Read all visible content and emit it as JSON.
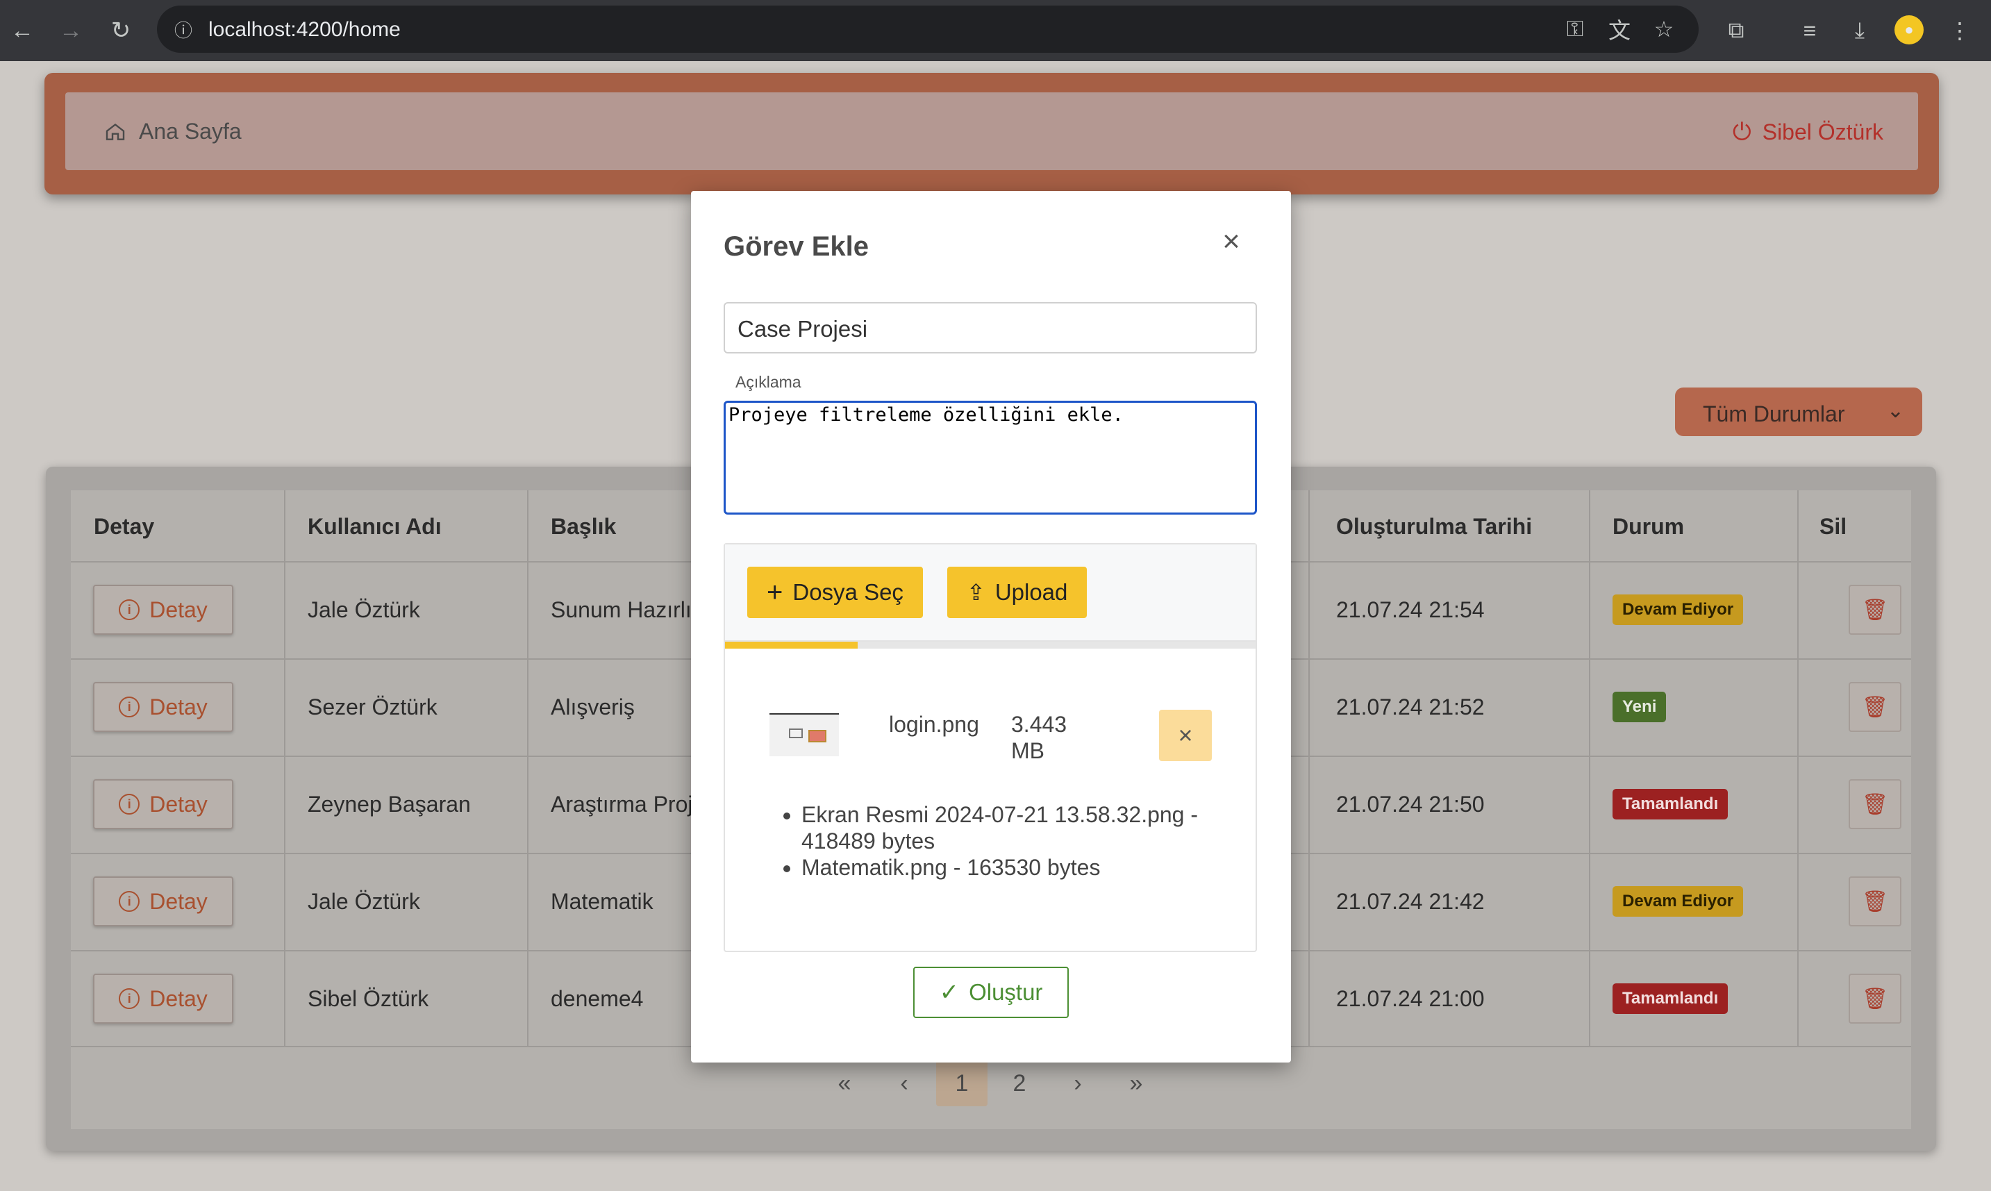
{
  "browser": {
    "url": "localhost:4200/home"
  },
  "header": {
    "home_label": "Ana Sayfa",
    "user_name": "Sibel Öztürk"
  },
  "filter": {
    "selected": "Tüm Durumlar"
  },
  "table": {
    "columns": [
      "Detay",
      "Kullanıcı Adı",
      "Başlık",
      "Oluşturulma Tarihi",
      "Durum",
      "Sil"
    ],
    "detail_label": "Detay",
    "rows": [
      {
        "user": "Jale Öztürk",
        "title": "Sunum Hazırlı",
        "date": "21.07.24 21:54",
        "status": "Devam Ediyor"
      },
      {
        "user": "Sezer Öztürk",
        "title": "Alışveriş",
        "date": "21.07.24 21:52",
        "status": "Yeni"
      },
      {
        "user": "Zeynep Başaran",
        "title": "Araştırma Proj",
        "date": "21.07.24 21:50",
        "status": "Tamamlandı"
      },
      {
        "user": "Jale Öztürk",
        "title": "Matematik",
        "date": "21.07.24 21:42",
        "status": "Devam Ediyor"
      },
      {
        "user": "Sibel Öztürk",
        "title": "deneme4",
        "date": "21.07.24 21:00",
        "status": "Tamamlandı"
      }
    ]
  },
  "pagination": {
    "first": "«",
    "prev": "‹",
    "pages": [
      "1",
      "2"
    ],
    "current": "1",
    "next": "›",
    "last": "»"
  },
  "modal": {
    "title": "Görev Ekle",
    "title_value": "Case Projesi",
    "description_label": "Açıklama",
    "description_value": "Projeye filtreleme özelliğini ekle.",
    "choose_file_label": "Dosya Seç",
    "upload_label": "Upload",
    "upload_progress_percent": 25,
    "pending_file": {
      "name": "login.png",
      "size": "3.443 MB"
    },
    "uploaded_files": [
      "Ekran Resmi 2024-07-21 13.58.32.png - 418489 bytes",
      "Matematik.png - 163530 bytes"
    ],
    "submit_label": "Oluştur"
  },
  "colors": {
    "accent": "#f5c32c",
    "success": "#4c8f34",
    "danger": "#9c2121",
    "focus": "#1e56c8"
  }
}
